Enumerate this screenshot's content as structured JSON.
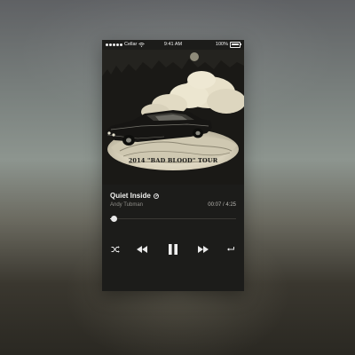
{
  "status_bar": {
    "carrier": "Cellar",
    "time": "9:41 AM",
    "battery": "100%",
    "signal_icon": "signal-dots-icon",
    "wifi_icon": "wifi-icon",
    "battery_icon": "battery-icon"
  },
  "artwork": {
    "caption": "2014 \"BAD BLOOD\" TOUR"
  },
  "track": {
    "title": "Quiet Inside",
    "artist": "Andy Tubman",
    "time_display": "00:07 / 4:25",
    "progress": 0.03,
    "badge_icon": "explicit-badge-icon"
  },
  "controls": {
    "shuffle_icon": "shuffle-icon",
    "previous_icon": "rewind-icon",
    "pause_icon": "pause-icon",
    "next_icon": "fast-forward-icon",
    "repeat_icon": "repeat-icon"
  },
  "colors": {
    "accent": "#e8e8e8",
    "panel": "#1c1c1a",
    "secondary_text": "#8e8d88"
  }
}
